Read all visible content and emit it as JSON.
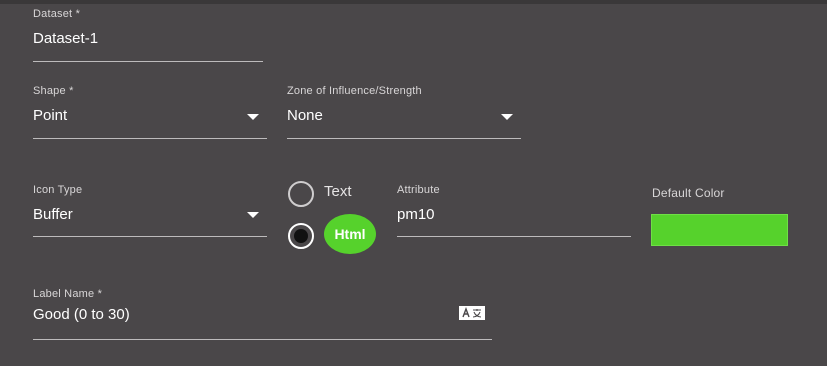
{
  "form": {
    "dataset": {
      "label": "Dataset *",
      "value": "Dataset-1"
    },
    "shape": {
      "label": "Shape *",
      "value": "Point"
    },
    "zone": {
      "label": "Zone of Influence/Strength",
      "value": "None"
    },
    "icon_type": {
      "label": "Icon Type",
      "value": "Buffer"
    },
    "radio": {
      "text_label": "Text",
      "html_label": "Html",
      "selected": "Html"
    },
    "attribute": {
      "label": "Attribute",
      "value": "pm10"
    },
    "default_color": {
      "label": "Default Color",
      "color": "#56d22c"
    },
    "label_name": {
      "label": "Label Name *",
      "value": "Good (0 to 30)",
      "icon": "translate-icon"
    }
  },
  "colors": {
    "background": "#4a4749",
    "accent_green": "#56d22c"
  }
}
